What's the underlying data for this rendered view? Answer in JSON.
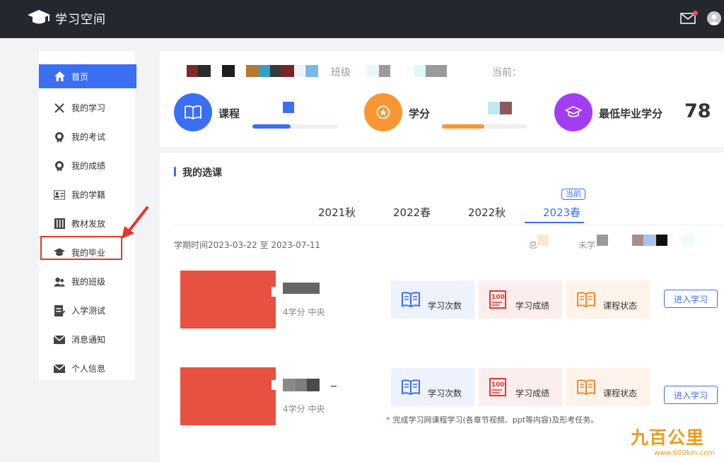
{
  "header": {
    "app_title": "学习空间",
    "icons": [
      "graduation-cap-icon",
      "mail-icon",
      "avatar"
    ]
  },
  "sidebar": {
    "items": [
      {
        "label": "首页",
        "icon": "home-icon",
        "active": true
      },
      {
        "label": "我的学习",
        "icon": "pencil-ruler-icon"
      },
      {
        "label": "我的考试",
        "icon": "award-icon"
      },
      {
        "label": "我的成绩",
        "icon": "medal-icon"
      },
      {
        "label": "我的学籍",
        "icon": "id-card-icon"
      },
      {
        "label": "教材发放",
        "icon": "books-icon"
      },
      {
        "label": "我的毕业",
        "icon": "graduation-cap-icon"
      },
      {
        "label": "我的班级",
        "icon": "users-icon"
      },
      {
        "label": "入学测试",
        "icon": "edit-doc-icon"
      },
      {
        "label": "消息通知",
        "icon": "envelope-icon"
      },
      {
        "label": "个人信息",
        "icon": "envelope-icon"
      }
    ]
  },
  "summary": {
    "class_label": "班级",
    "current_label": "当前：",
    "stats": [
      {
        "name": "课程",
        "icon": "book-icon",
        "color": "#3b6ff2",
        "progress": 0.45
      },
      {
        "name": "学分",
        "icon": "star-badge-icon",
        "color": "#f79633",
        "progress": 0.5
      },
      {
        "name": "最低毕业学分",
        "icon": "graduation-cap-icon",
        "color": "#a33df2",
        "value": "78"
      }
    ]
  },
  "courses_section": {
    "title": "我的选课",
    "tabs": [
      {
        "label": "2021秋",
        "active": false
      },
      {
        "label": "2022春",
        "active": false
      },
      {
        "label": "2022秋",
        "active": false
      },
      {
        "label": "2023春",
        "active": true
      }
    ],
    "current_badge": "当前",
    "term_time": "学期时间2023-03-22 至 2023-07-11",
    "stats_line": {
      "total": "总",
      "not_learned": "未学"
    },
    "courses": [
      {
        "credit_info": "4学分 中央",
        "metrics": [
          {
            "label": "学习次数",
            "icon": "open-book-icon"
          },
          {
            "label": "学习成绩",
            "icon": "score-100-icon"
          },
          {
            "label": "课程状态",
            "icon": "open-book-icon"
          }
        ],
        "enter_label": "进入学习"
      },
      {
        "credit_info": "4学分 中央",
        "metrics": [
          {
            "label": "学习次数",
            "icon": "open-book-icon"
          },
          {
            "label": "学习成绩",
            "icon": "score-100-icon"
          },
          {
            "label": "课程状态",
            "icon": "open-book-icon"
          }
        ],
        "enter_label": "进入学习"
      }
    ],
    "note": "完成学习网课程学习(各章节视频、ppt等内容)及形考任务。",
    "note_star": "*"
  },
  "watermark": {
    "brand": "九百公里",
    "url": "www.600km.com"
  },
  "colors": {
    "header_bg": "#24272e",
    "accent": "#3b6ff2",
    "orange": "#f79633",
    "purple": "#a33df2",
    "thumb_red": "#e65141",
    "annotation_red": "#e8362b"
  }
}
